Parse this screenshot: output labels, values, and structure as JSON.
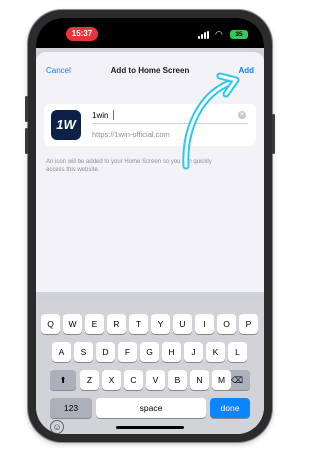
{
  "status_bar": {
    "time": "15:37",
    "battery_level": "35",
    "battery_color": "#34c759",
    "recording_color": "#e9343b"
  },
  "header": {
    "cancel_label": "Cancel",
    "title": "Add to Home Screen",
    "add_label": "Add"
  },
  "app_card": {
    "icon_text": "1W",
    "name_value": "1win",
    "url": "https://1win-official.com"
  },
  "description": "An icon will be added to your Home Screen so you can quickly access this website.",
  "keyboard": {
    "row1": [
      "Q",
      "W",
      "E",
      "R",
      "T",
      "Y",
      "U",
      "I",
      "O",
      "P"
    ],
    "row2": [
      "A",
      "S",
      "D",
      "F",
      "G",
      "H",
      "J",
      "K",
      "L"
    ],
    "row3": [
      "Z",
      "X",
      "C",
      "V",
      "B",
      "N",
      "M"
    ],
    "numbers_label": "123",
    "space_label": "space",
    "done_label": "done"
  },
  "accent_color": "#0a84ff",
  "annotation_arrow_color": "#29c8ee"
}
